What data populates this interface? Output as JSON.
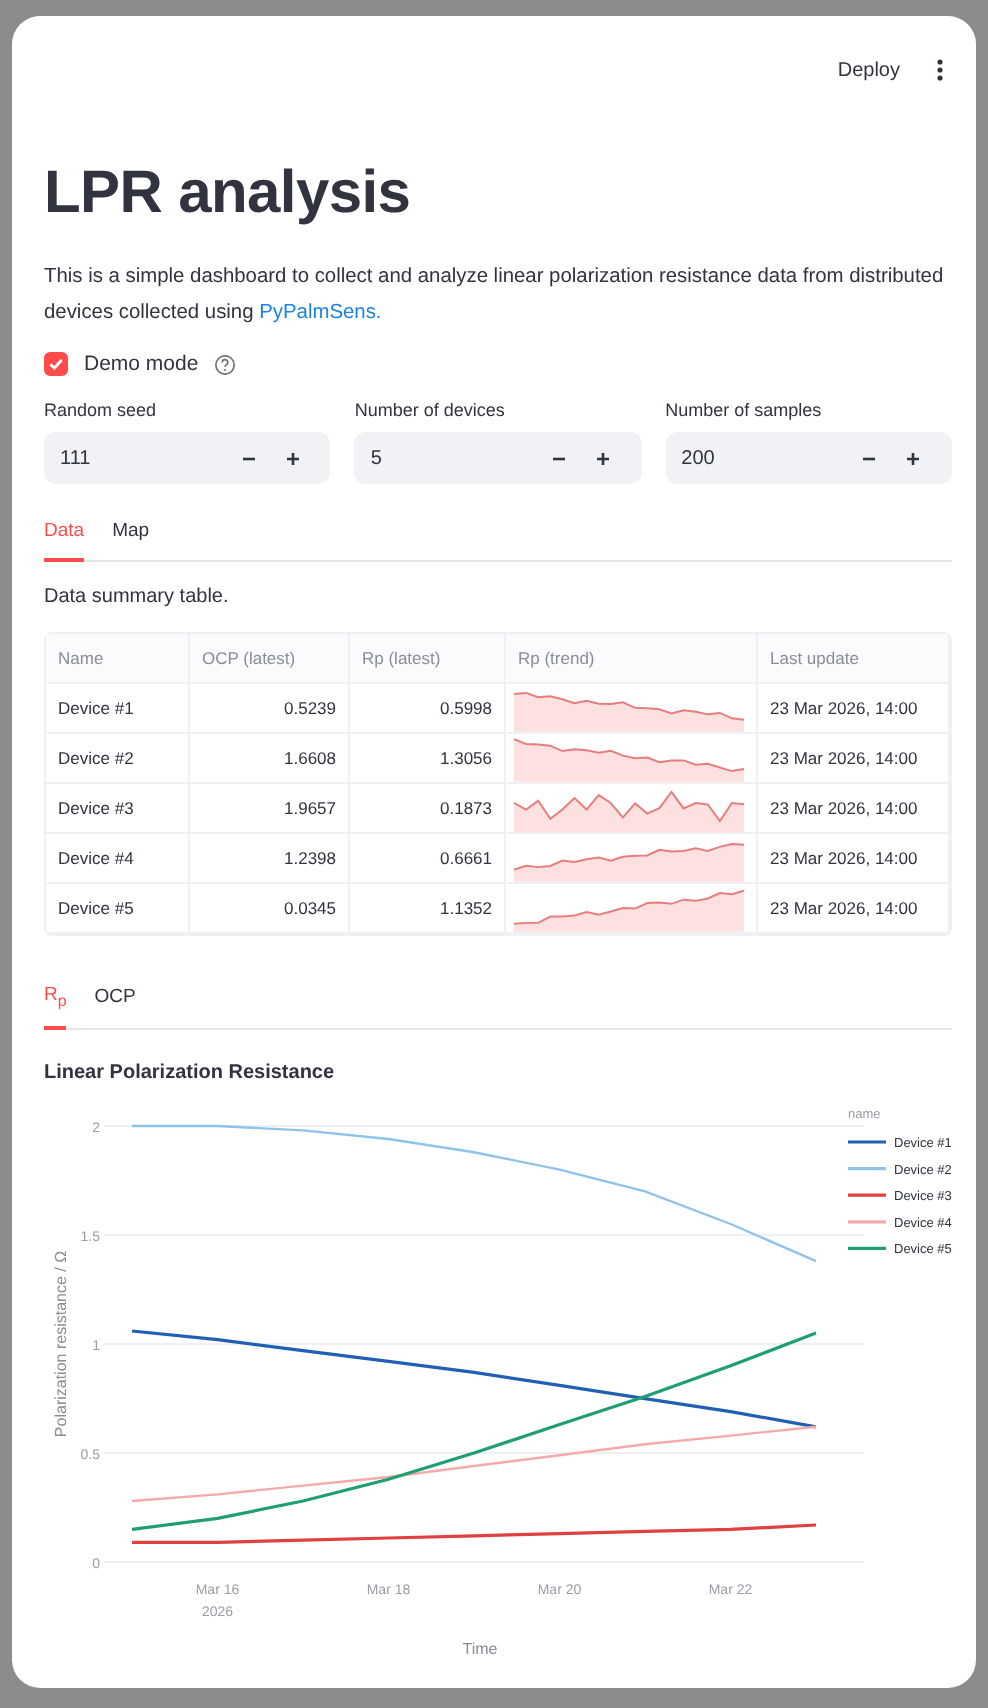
{
  "header": {
    "deploy_label": "Deploy"
  },
  "title": "LPR analysis",
  "intro": "This is a simple dashboard to collect and analyze linear polarization resistance data from distributed devices collected using ",
  "intro_link": "PyPalmSens.",
  "demo_mode": {
    "label": "Demo mode",
    "checked": true
  },
  "inputs": [
    {
      "label": "Random seed",
      "value": "111"
    },
    {
      "label": "Number of devices",
      "value": "5"
    },
    {
      "label": "Number of samples",
      "value": "200"
    }
  ],
  "tabs": [
    {
      "label": "Data",
      "selected": true
    },
    {
      "label": "Map",
      "selected": false
    }
  ],
  "caption": "Data summary table.",
  "table": {
    "columns": [
      "Name",
      "OCP (latest)",
      "Rp (latest)",
      "Rp (trend)",
      "Last update"
    ],
    "rows": [
      {
        "name": "Device #1",
        "ocp": "0.5239",
        "rp": "0.5998",
        "updated": "23 Mar 2026, 14:00"
      },
      {
        "name": "Device #2",
        "ocp": "1.6608",
        "rp": "1.3056",
        "updated": "23 Mar 2026, 14:00"
      },
      {
        "name": "Device #3",
        "ocp": "1.9657",
        "rp": "0.1873",
        "updated": "23 Mar 2026, 14:00"
      },
      {
        "name": "Device #4",
        "ocp": "1.2398",
        "rp": "0.6661",
        "updated": "23 Mar 2026, 14:00"
      },
      {
        "name": "Device #5",
        "ocp": "0.0345",
        "rp": "1.1352",
        "updated": "23 Mar 2026, 14:00"
      }
    ]
  },
  "chart_tabs": [
    {
      "label": "R$_{p}$",
      "selected": true
    },
    {
      "label": "OCP",
      "selected": false
    }
  ],
  "chart_data": {
    "type": "line",
    "title": "Linear Polarization Resistance",
    "xlabel": "Time",
    "ylabel": "Polarization resistance / Ω",
    "legend_title": "name",
    "grid": true,
    "legend": "right",
    "ylim": [
      0,
      2
    ],
    "categories": [
      null,
      "Mar 16\n2026",
      null,
      "Mar 18",
      null,
      "Mar 20",
      null,
      "Mar 22",
      null
    ],
    "yticks": [
      {
        "value": 0,
        "label": "0"
      },
      {
        "value": 0.5,
        "label": "0.5"
      },
      {
        "value": 1,
        "label": "1"
      },
      {
        "value": 1.5,
        "label": "1.5"
      },
      {
        "value": 2,
        "label": "2"
      }
    ],
    "series": [
      {
        "name": "Device #1",
        "color": "#1f5fb4",
        "values": [
          1.06,
          1.02,
          0.97,
          0.92,
          0.87,
          0.81,
          0.75,
          0.69,
          0.62
        ]
      },
      {
        "name": "Device #2",
        "color": "#8ec4ec",
        "values": [
          2.0,
          2.0,
          1.98,
          1.94,
          1.88,
          1.8,
          1.7,
          1.55,
          1.38
        ]
      },
      {
        "name": "Device #3",
        "color": "#e0403f",
        "values": [
          0.09,
          0.09,
          0.1,
          0.11,
          0.12,
          0.13,
          0.14,
          0.15,
          0.17
        ]
      },
      {
        "name": "Device #4",
        "color": "#f5a9a9",
        "values": [
          0.28,
          0.31,
          0.35,
          0.39,
          0.44,
          0.49,
          0.54,
          0.58,
          0.62
        ]
      },
      {
        "name": "Device #5",
        "color": "#1f9e74",
        "values": [
          0.15,
          0.2,
          0.28,
          0.38,
          0.5,
          0.63,
          0.76,
          0.9,
          1.05
        ]
      }
    ]
  }
}
